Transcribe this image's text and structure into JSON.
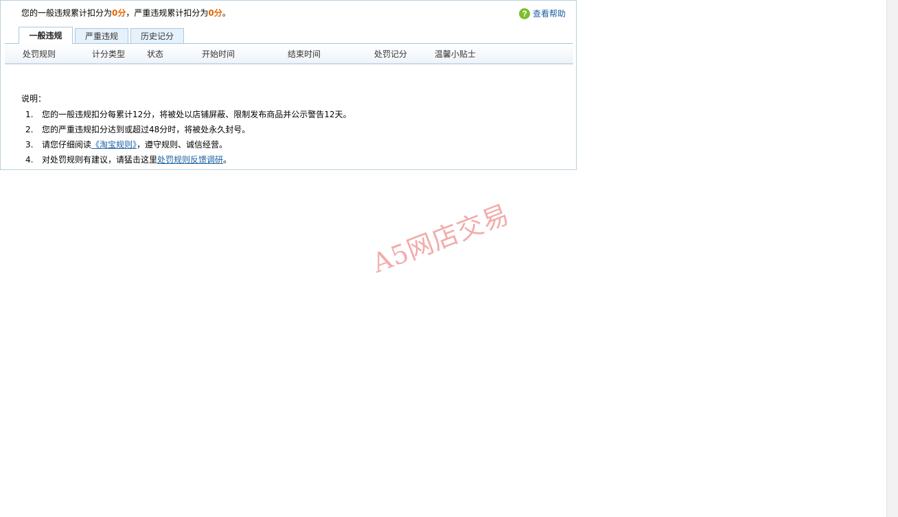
{
  "summary": {
    "prefix": "您的一般违规累计扣分为",
    "general_score": "0分",
    "middle": "，严重违规累计扣分为",
    "serious_score": "0分",
    "suffix": "。"
  },
  "help": {
    "icon": "question-circle-icon",
    "label": "查看帮助"
  },
  "tabs": [
    {
      "label": "一般违规",
      "active": true
    },
    {
      "label": "严重违规",
      "active": false
    },
    {
      "label": "历史记分",
      "active": false
    }
  ],
  "table": {
    "columns": [
      "处罚规则",
      "计分类型",
      "状态",
      "开始时间",
      "结束时间",
      "处罚记分",
      "温馨小贴士"
    ],
    "rows": []
  },
  "notes": {
    "title": "说明：",
    "items": [
      {
        "num": "1.",
        "text": "您的一般违规扣分每累计12分，将被处以店铺屏蔽、限制发布商品并公示警告12天。"
      },
      {
        "num": "2.",
        "text": "您的严重违规扣分达到或超过48分时，将被处永久封号。"
      },
      {
        "num": "3.",
        "before": "请您仔细阅读",
        "link": "《淘宝规则》",
        "after": "，遵守规则、诚信经营。"
      },
      {
        "num": "4.",
        "before": "对处罚规则有建议，请猛击这里",
        "link": "处罚规则反馈调研",
        "after": "。"
      }
    ]
  },
  "watermark": "A5网店交易",
  "colors": {
    "score": "#e06600",
    "link": "#1a5fa4",
    "border": "#b9d0dc",
    "tab_bg": "#e6f2fb",
    "watermark": "#e76868"
  }
}
